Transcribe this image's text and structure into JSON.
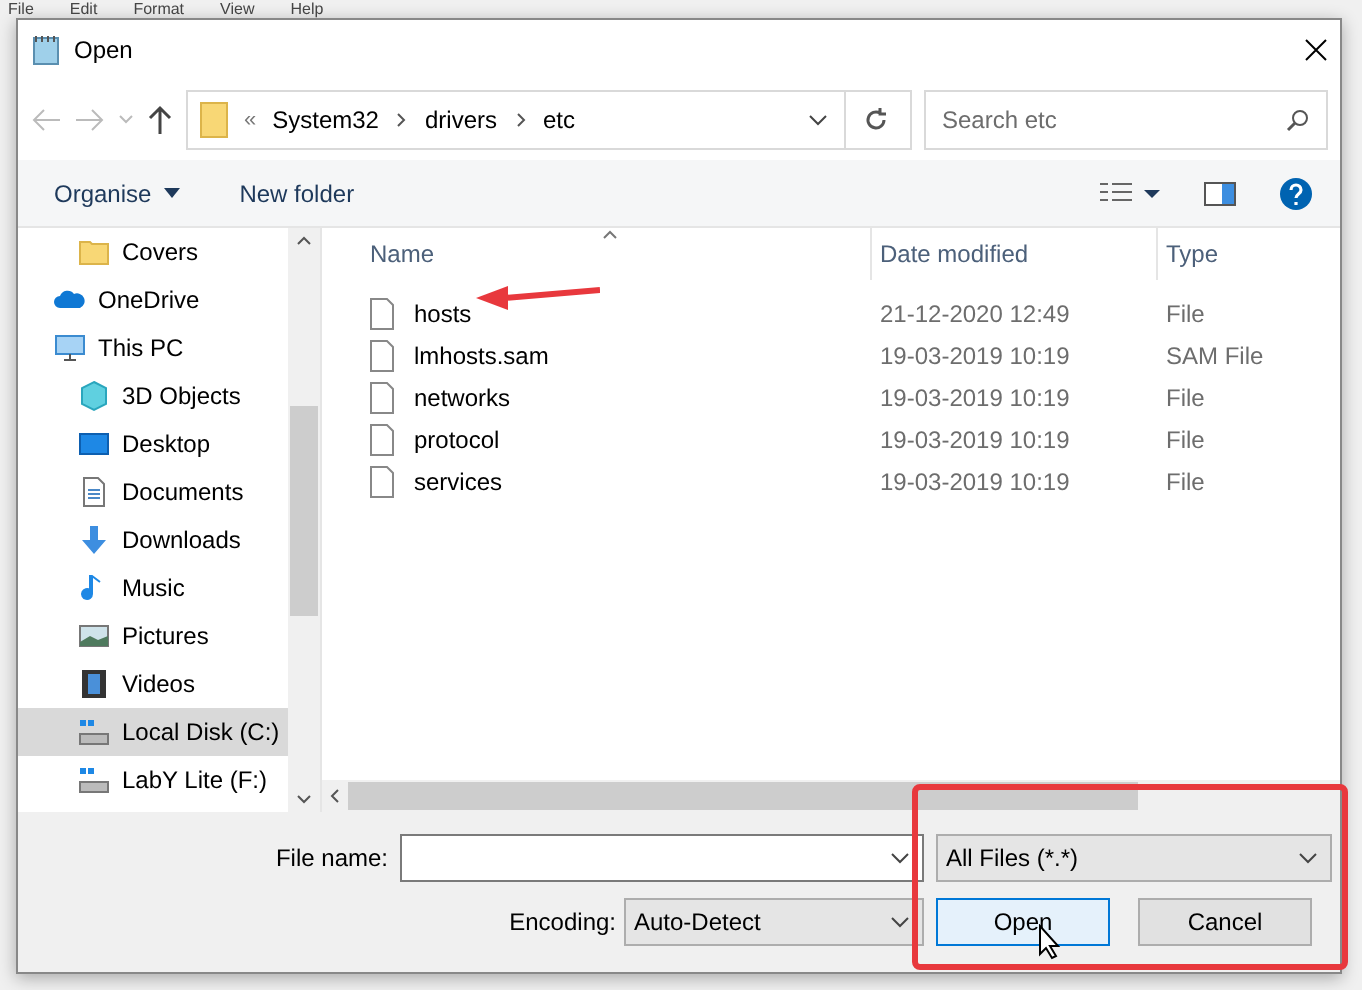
{
  "menu_bar": [
    "File",
    "Edit",
    "Format",
    "View",
    "Help"
  ],
  "window": {
    "title": "Open"
  },
  "address": {
    "overflow": "«",
    "path": [
      "System32",
      "drivers",
      "etc"
    ]
  },
  "search": {
    "placeholder": "Search etc"
  },
  "toolbar": {
    "organise": "Organise",
    "new_folder": "New folder"
  },
  "sidebar": {
    "items": [
      {
        "label": "Covers",
        "kind": "folder",
        "selected": false
      },
      {
        "label": "OneDrive",
        "kind": "cloud",
        "selected": false
      },
      {
        "label": "This PC",
        "kind": "pc",
        "selected": false,
        "children": [
          {
            "label": "3D Objects",
            "kind": "cube",
            "selected": false
          },
          {
            "label": "Desktop",
            "kind": "desktop",
            "selected": false
          },
          {
            "label": "Documents",
            "kind": "documents",
            "selected": false
          },
          {
            "label": "Downloads",
            "kind": "downloads",
            "selected": false
          },
          {
            "label": "Music",
            "kind": "music",
            "selected": false
          },
          {
            "label": "Pictures",
            "kind": "pictures",
            "selected": false
          },
          {
            "label": "Videos",
            "kind": "videos",
            "selected": false
          },
          {
            "label": "Local Disk (C:)",
            "kind": "disk",
            "selected": true
          },
          {
            "label": "LabY Lite (F:)",
            "kind": "disk",
            "selected": false
          }
        ]
      }
    ]
  },
  "table": {
    "columns": [
      "Name",
      "Date modified",
      "Type"
    ],
    "rows": [
      {
        "name": "hosts",
        "date": "21-12-2020 12:49",
        "type": "File",
        "annotated": true
      },
      {
        "name": "lmhosts.sam",
        "date": "19-03-2019 10:19",
        "type": "SAM File",
        "annotated": false
      },
      {
        "name": "networks",
        "date": "19-03-2019 10:19",
        "type": "File",
        "annotated": false
      },
      {
        "name": "protocol",
        "date": "19-03-2019 10:19",
        "type": "File",
        "annotated": false
      },
      {
        "name": "services",
        "date": "19-03-2019 10:19",
        "type": "File",
        "annotated": false
      }
    ]
  },
  "footer": {
    "file_name_label": "File name:",
    "filter": "All Files  (*.*)",
    "encoding_label": "Encoding:",
    "encoding": "Auto-Detect",
    "open": "Open",
    "cancel": "Cancel"
  }
}
